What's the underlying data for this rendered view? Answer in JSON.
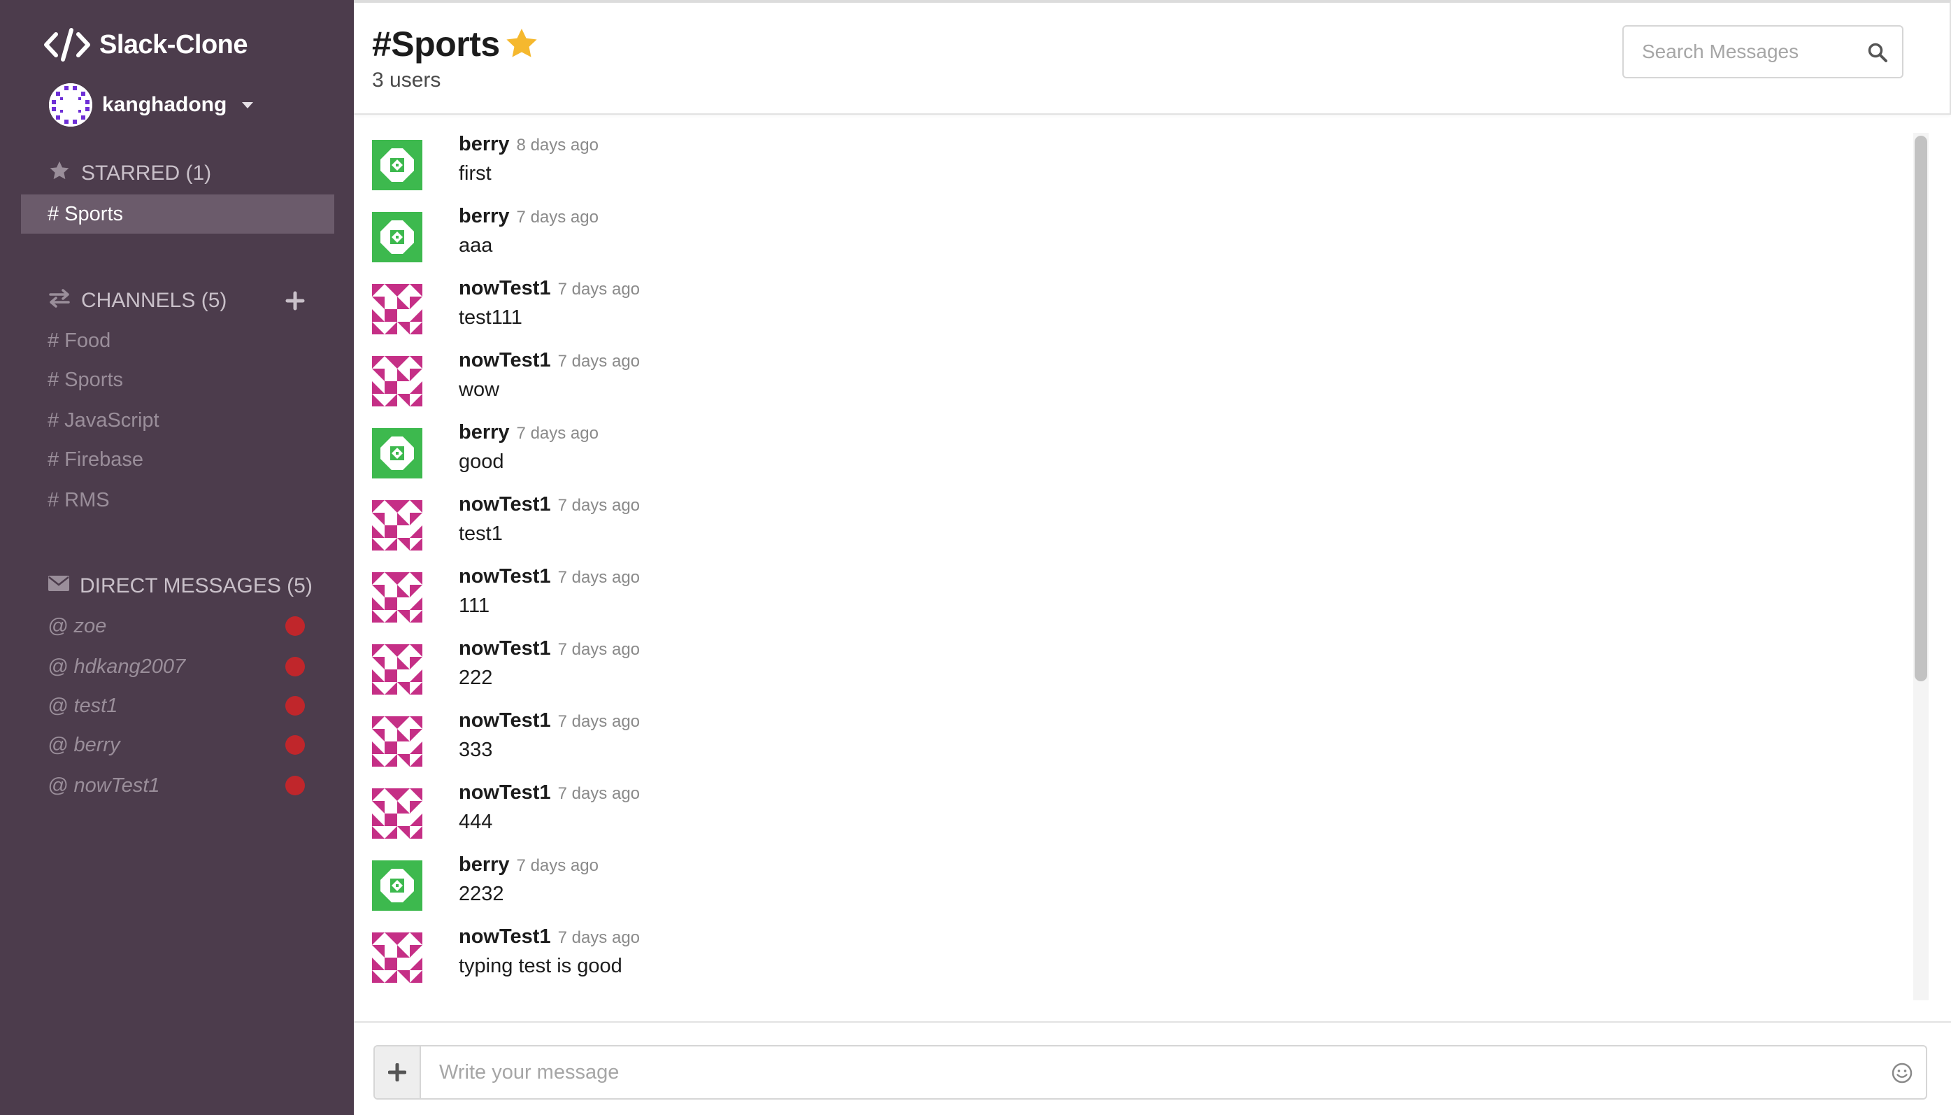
{
  "app": {
    "title": "Slack-Clone"
  },
  "user": {
    "name": "kanghadong"
  },
  "starred": {
    "label": "STARRED (1)",
    "items": [
      {
        "label": "# Sports",
        "active": true
      }
    ]
  },
  "channels": {
    "label": "CHANNELS (5)",
    "items": [
      {
        "label": "# Food"
      },
      {
        "label": "# Sports"
      },
      {
        "label": "# JavaScript"
      },
      {
        "label": "# Firebase"
      },
      {
        "label": "# RMS"
      }
    ]
  },
  "direct_messages": {
    "label": "DIRECT MESSAGES (5)",
    "items": [
      {
        "label": "@ zoe",
        "status": "offline"
      },
      {
        "label": "@ hdkang2007",
        "status": "offline"
      },
      {
        "label": "@ test1",
        "status": "offline"
      },
      {
        "label": "@ berry",
        "status": "offline"
      },
      {
        "label": "@ nowTest1",
        "status": "offline"
      }
    ]
  },
  "header": {
    "channel_name": "#Sports",
    "user_count": "3 users",
    "search_placeholder": "Search Messages"
  },
  "messages": [
    {
      "author": "berry",
      "time": "8 days ago",
      "text": "first"
    },
    {
      "author": "berry",
      "time": "7 days ago",
      "text": "aaa"
    },
    {
      "author": "nowTest1",
      "time": "7 days ago",
      "text": "test111"
    },
    {
      "author": "nowTest1",
      "time": "7 days ago",
      "text": "wow"
    },
    {
      "author": "berry",
      "time": "7 days ago",
      "text": "good"
    },
    {
      "author": "nowTest1",
      "time": "7 days ago",
      "text": "test1"
    },
    {
      "author": "nowTest1",
      "time": "7 days ago",
      "text": "111"
    },
    {
      "author": "nowTest1",
      "time": "7 days ago",
      "text": "222"
    },
    {
      "author": "nowTest1",
      "time": "7 days ago",
      "text": "333"
    },
    {
      "author": "nowTest1",
      "time": "7 days ago",
      "text": "444"
    },
    {
      "author": "berry",
      "time": "7 days ago",
      "text": "2232"
    },
    {
      "author": "nowTest1",
      "time": "7 days ago",
      "text": "typing test is good"
    }
  ],
  "composer": {
    "placeholder": "Write your message"
  },
  "colors": {
    "sidebar_bg": "#4c3c4c",
    "sidebar_active": "#6b5b6b",
    "presence_offline": "#c0262b",
    "star": "#f5b82e",
    "avatar_berry": "#3db94e",
    "avatar_nowtest1": "#c52f86"
  },
  "icons": {
    "brand": "code-icon",
    "starred": "star-icon",
    "channels": "exchange-icon",
    "direct_messages": "envelope-icon",
    "add_channel": "plus-icon",
    "search": "search-icon",
    "composer_add": "plus-icon",
    "emoji": "smile-icon"
  }
}
